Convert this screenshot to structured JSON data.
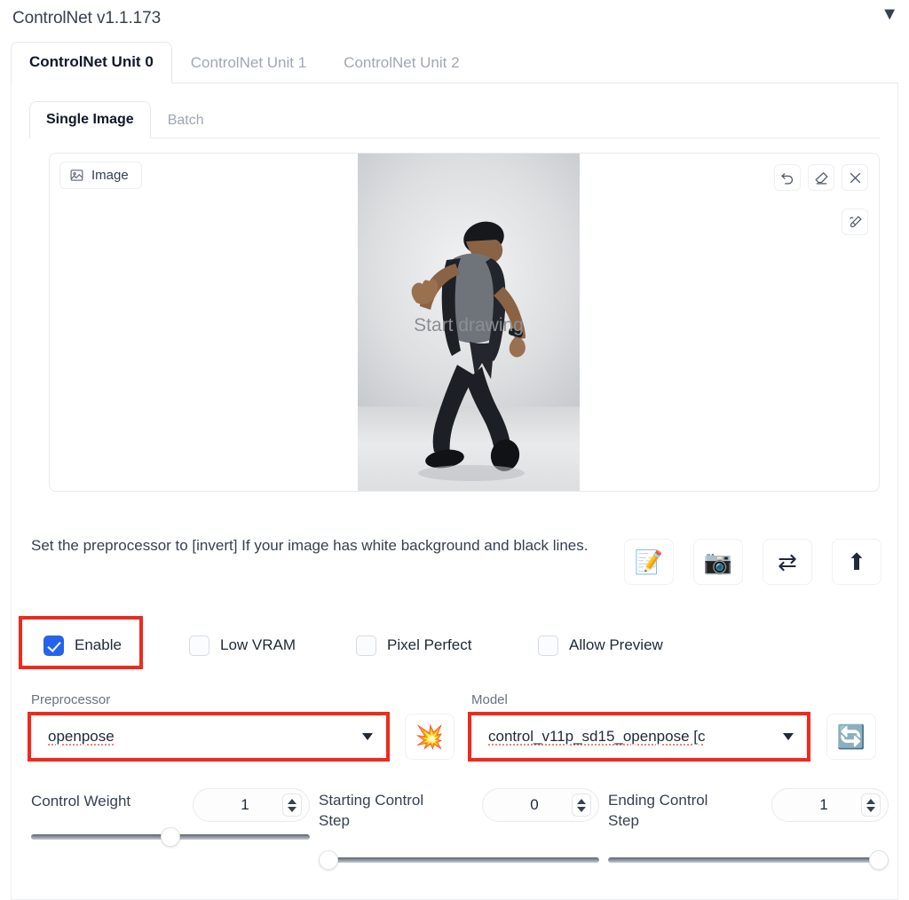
{
  "accordion": {
    "title": "ControlNet v1.1.173",
    "caret_icon": "chevron-down-icon",
    "caret_glyph": "▼"
  },
  "unit_tabs": [
    {
      "label": "ControlNet Unit 0",
      "active": true
    },
    {
      "label": "ControlNet Unit 1",
      "active": false
    },
    {
      "label": "ControlNet Unit 2",
      "active": false
    }
  ],
  "source_tabs": [
    {
      "label": "Single Image",
      "active": true
    },
    {
      "label": "Batch",
      "active": false
    }
  ],
  "image_panel": {
    "badge_label": "Image",
    "badge_icon": "image-icon",
    "overlay_text": "Start drawing",
    "tools": [
      {
        "name": "undo-icon",
        "title": "Undo"
      },
      {
        "name": "eraser-icon",
        "title": "Erase"
      },
      {
        "name": "close-icon",
        "title": "Remove image"
      }
    ],
    "tools_second_row": [
      {
        "name": "brush-icon",
        "title": "Brush"
      }
    ]
  },
  "hint": {
    "text": "Set the preprocessor to [invert] If your image has white background and black lines."
  },
  "action_buttons": [
    {
      "name": "open-new-canvas-button",
      "glyph": "📝"
    },
    {
      "name": "webcam-button",
      "glyph": "📷"
    },
    {
      "name": "mirror-webcam-button",
      "glyph": "⇄"
    },
    {
      "name": "send-dimensions-button",
      "glyph": "⬆"
    }
  ],
  "checkboxes": [
    {
      "label": "Enable",
      "checked": true,
      "highlighted": true
    },
    {
      "label": "Low VRAM",
      "checked": false,
      "highlighted": false
    },
    {
      "label": "Pixel Perfect",
      "checked": false,
      "highlighted": false
    },
    {
      "label": "Allow Preview",
      "checked": false,
      "highlighted": false
    }
  ],
  "preprocessor": {
    "label": "Preprocessor",
    "value": "openpose",
    "highlighted": true,
    "run_button_glyph": "💥",
    "run_button_name": "run-preprocessor-button"
  },
  "model": {
    "label": "Model",
    "value": "control_v11p_sd15_openpose [c",
    "highlighted": true,
    "refresh_button_glyph": "🔄",
    "refresh_button_name": "refresh-models-button"
  },
  "sliders": [
    {
      "label": "Control Weight",
      "value": "1",
      "fill_percent": 50
    },
    {
      "label": "Starting Control Step",
      "value": "0",
      "fill_percent": 0
    },
    {
      "label": "Ending Control Step",
      "value": "1",
      "fill_percent": 100
    }
  ],
  "colors": {
    "accent_blue": "#2563eb",
    "annotation_red": "#ee2a1e",
    "tab_inactive": "#a1a7b3",
    "text_primary": "#1f2937",
    "border": "#e8eaed"
  }
}
